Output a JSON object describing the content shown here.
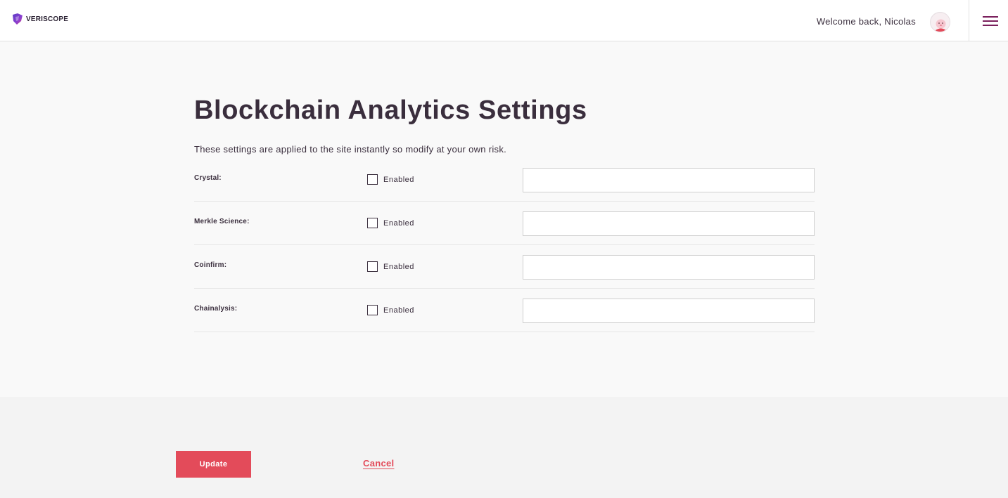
{
  "header": {
    "logo_text": "VERISCOPE",
    "welcome_text": "Welcome back, Nicolas",
    "menu_icon": "hamburger-menu-icon",
    "accent_color": "#7a1f5c"
  },
  "main": {
    "title": "Blockchain Analytics Settings",
    "description": "These settings are applied to the site instantly so modify at your own risk.",
    "rows": [
      {
        "label": "Crystal:",
        "checkbox_label": "Enabled",
        "checked": false,
        "input_value": ""
      },
      {
        "label": "Merkle Science:",
        "checkbox_label": "Enabled",
        "checked": false,
        "input_value": ""
      },
      {
        "label": "Coinfirm:",
        "checkbox_label": "Enabled",
        "checked": false,
        "input_value": ""
      },
      {
        "label": "Chainalysis:",
        "checkbox_label": "Enabled",
        "checked": false,
        "input_value": ""
      }
    ]
  },
  "footer": {
    "update_label": "Update",
    "cancel_label": "Cancel",
    "button_color": "#e34b5a"
  }
}
